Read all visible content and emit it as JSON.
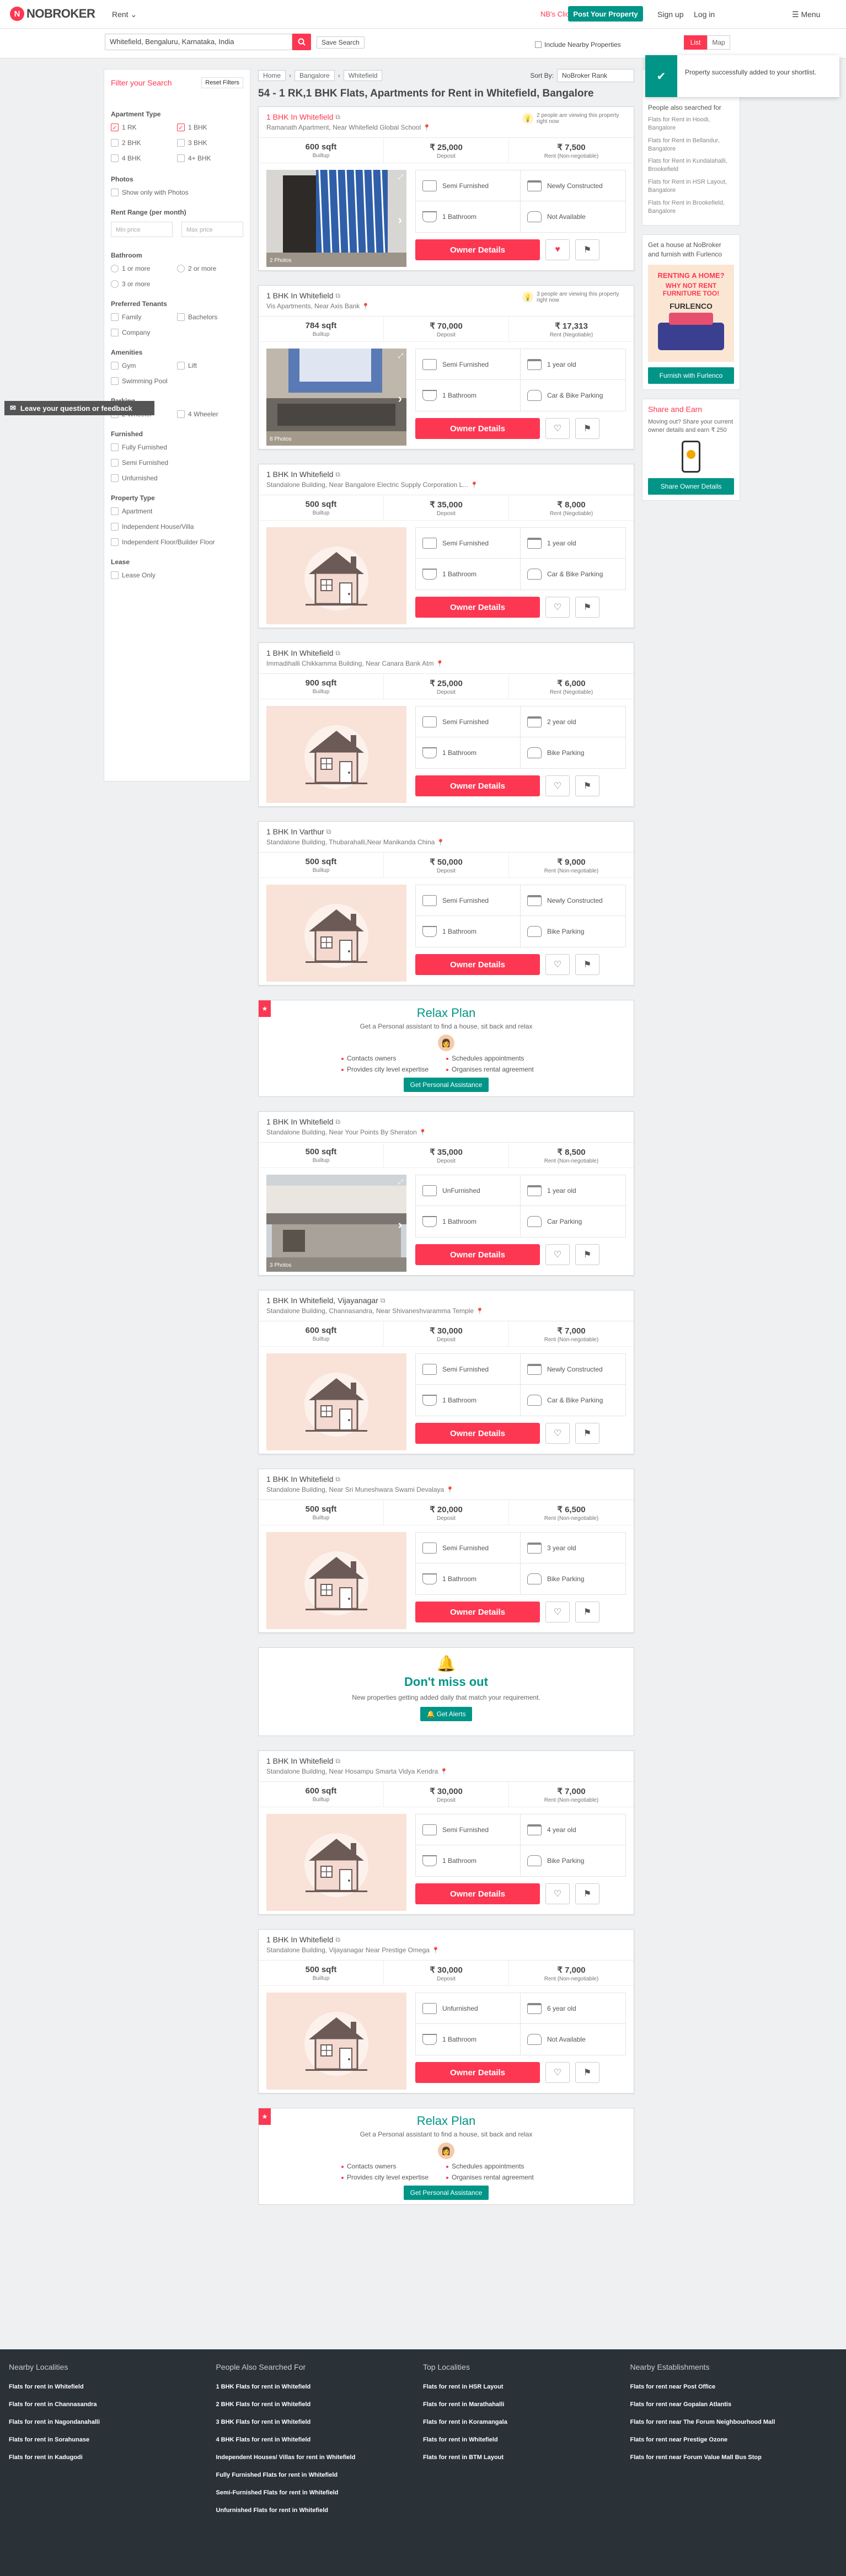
{
  "nav": {
    "logo_initial": "N",
    "logo_text": "NOBROKER",
    "rent_dropdown": "Rent ⌄",
    "help_link": "NB's Click Here!",
    "post_button": "Post Your Property",
    "signup": "Sign up",
    "login": "Log in",
    "menu": "☰ Menu"
  },
  "search": {
    "value": "Whitefield, Bengaluru, Karnataka, India",
    "save_label": "Save Search",
    "nearby_label": "Include Nearby Properties",
    "list_label": "List",
    "map_label": "Map"
  },
  "toast": {
    "message": "Property successfully added to your shortlist."
  },
  "filters": {
    "title": "Filter your Search",
    "reset": "Reset Filters",
    "apartment_type_label": "Apartment Type",
    "apartment_types": [
      {
        "label": "1 RK",
        "checked": "✓"
      },
      {
        "label": "1 BHK",
        "checked": "✓"
      },
      {
        "label": "2 BHK",
        "checked": ""
      },
      {
        "label": "3 BHK",
        "checked": ""
      },
      {
        "label": "4 BHK",
        "checked": ""
      },
      {
        "label": "4+ BHK",
        "checked": ""
      }
    ],
    "photos_label": "Photos",
    "photos_option": "Show only with Photos",
    "rent_range_label": "Rent Range (per month)",
    "min_price": "Min price",
    "max_price": "Max price",
    "bathroom_label": "Bathroom",
    "bathroom_options": [
      "1 or more",
      "2 or more",
      "3 or more"
    ],
    "tenants_label": "Preferred Tenants",
    "tenants_options": [
      "Family",
      "Bachelors",
      "Company"
    ],
    "amenities_label": "Amenities",
    "amenities_options": [
      "Gym",
      "Lift",
      "Swimming Pool"
    ],
    "parking_label": "Parking",
    "parking_options": [
      "2 Wheeler",
      "4 Wheeler"
    ],
    "furnished_label": "Furnished",
    "furnished_options": [
      "Fully Furnished",
      "Semi Furnished",
      "Unfurnished"
    ],
    "property_type_label": "Property Type",
    "property_type_options": [
      "Apartment",
      "Independent House/Villa",
      "Independent Floor/Builder Floor"
    ],
    "lease_label": "Lease",
    "lease_option": "Lease Only"
  },
  "feedback": {
    "label": "Leave your question or feedback"
  },
  "breadcrumb": {
    "items": [
      "Home",
      "Bangalore",
      "Whitefield"
    ]
  },
  "sort": {
    "label": "Sort By:",
    "value": "NoBroker Rank"
  },
  "page_title": "54 - 1 RK,1 BHK Flats, Apartments for Rent in Whitefield, Bangalore",
  "listings": [
    {
      "title": "1 BHK In Whitefield",
      "subtitle": "Ramanath Apartment, Near Whitefield Global School",
      "viewing": "2 people are viewing this property right now",
      "area": "600 sqft",
      "area_label": "Builtup",
      "deposit": "₹ 25,000",
      "deposit_label": "Deposit",
      "rent": "₹ 7,500",
      "rent_label": "Rent (Non-negotiable)",
      "furnishing": "Semi Furnished",
      "age": "Newly Constructed",
      "bathrooms": "1 Bathroom",
      "parking": "Not Available",
      "photos": "2 Photos",
      "favorite": "♥"
    },
    {
      "title": "1 BHK In Whitefield",
      "subtitle": "Vis Apartments, Near Axis Bank",
      "viewing": "3 people are viewing this property right now",
      "area": "784 sqft",
      "area_label": "Builtup",
      "deposit": "₹ 70,000",
      "deposit_label": "Deposit",
      "rent": "₹ 17,313",
      "rent_label": "Rent (Negotiable)",
      "furnishing": "Semi Furnished",
      "age": "1 year old",
      "bathrooms": "1 Bathroom",
      "parking": "Car & Bike Parking",
      "photos": "8 Photos",
      "favorite": "♡"
    },
    {
      "title": "1 BHK In Whitefield",
      "subtitle": "Standalone Building, Near Bangalore Electric Supply Corporation L...",
      "area": "500 sqft",
      "area_label": "Builtup",
      "deposit": "₹ 35,000",
      "deposit_label": "Deposit",
      "rent": "₹ 8,000",
      "rent_label": "Rent (Negotiable)",
      "furnishing": "Semi Furnished",
      "age": "1 year old",
      "bathrooms": "1 Bathroom",
      "parking": "Car & Bike Parking",
      "favorite": "♡"
    },
    {
      "title": "1 BHK In Whitefield",
      "subtitle": "Immadihalli Chikkamma Building, Near Canara Bank Atm",
      "area": "900 sqft",
      "area_label": "Builtup",
      "deposit": "₹ 25,000",
      "deposit_label": "Deposit",
      "rent": "₹ 6,000",
      "rent_label": "Rent (Negotiable)",
      "furnishing": "Semi Furnished",
      "age": "2 year old",
      "bathrooms": "1 Bathroom",
      "parking": "Bike Parking",
      "favorite": "♡"
    },
    {
      "title": "1 BHK In Varthur",
      "subtitle": "Standalone Building, Thubarahalli,Near Manikanda China",
      "area": "500 sqft",
      "area_label": "Builtup",
      "deposit": "₹ 50,000",
      "deposit_label": "Deposit",
      "rent": "₹ 9,000",
      "rent_label": "Rent (Non-negotiable)",
      "furnishing": "Semi Furnished",
      "age": "Newly Constructed",
      "bathrooms": "1 Bathroom",
      "parking": "Bike Parking",
      "favorite": "♡"
    },
    {
      "title": "1 BHK In Whitefield",
      "subtitle": "Standalone Building, Near Your Points By Sheraton",
      "area": "500 sqft",
      "area_label": "Builtup",
      "deposit": "₹ 35,000",
      "deposit_label": "Deposit",
      "rent": "₹ 8,500",
      "rent_label": "Rent (Non-negotiable)",
      "furnishing": "UnFurnished",
      "age": "1 year old",
      "bathrooms": "1 Bathroom",
      "parking": "Car Parking",
      "photos": "3 Photos",
      "favorite": "♡"
    },
    {
      "title": "1 BHK In Whitefield, Vijayanagar",
      "subtitle": "Standalone Building, Channasandra, Near Shivaneshvaramma Temple",
      "area": "600 sqft",
      "area_label": "Builtup",
      "deposit": "₹ 30,000",
      "deposit_label": "Deposit",
      "rent": "₹ 7,000",
      "rent_label": "Rent (Non-negotiable)",
      "furnishing": "Semi Furnished",
      "age": "Newly Constructed",
      "bathrooms": "1 Bathroom",
      "parking": "Car & Bike Parking",
      "favorite": "♡"
    },
    {
      "title": "1 BHK In Whitefield",
      "subtitle": "Standalone Building, Near Sri Muneshwara Swami Devalaya",
      "area": "500 sqft",
      "area_label": "Builtup",
      "deposit": "₹ 20,000",
      "deposit_label": "Deposit",
      "rent": "₹ 6,500",
      "rent_label": "Rent (Non-negotiable)",
      "furnishing": "Semi Furnished",
      "age": "3 year old",
      "bathrooms": "1 Bathroom",
      "parking": "Bike Parking",
      "favorite": "♡"
    },
    {
      "title": "1 BHK In Whitefield",
      "subtitle": "Standalone Building, Near Hosampu Smarta Vidya Kendra",
      "area": "600 sqft",
      "area_label": "Builtup",
      "deposit": "₹ 30,000",
      "deposit_label": "Deposit",
      "rent": "₹ 7,000",
      "rent_label": "Rent (Non-negotiable)",
      "furnishing": "Semi Furnished",
      "age": "4 year old",
      "bathrooms": "1 Bathroom",
      "parking": "Bike Parking",
      "favorite": "♡"
    },
    {
      "title": "1 BHK In Whitefield",
      "subtitle": "Standalone Building, Vijayanagar Near Prestige Omega",
      "area": "500 sqft",
      "area_label": "Builtup",
      "deposit": "₹ 30,000",
      "deposit_label": "Deposit",
      "rent": "₹ 7,000",
      "rent_label": "Rent (Non-negotiable)",
      "furnishing": "Unfurnished",
      "age": "6 year old",
      "bathrooms": "1 Bathroom",
      "parking": "Not Available",
      "favorite": "♡"
    }
  ],
  "owner_button": "Owner Details",
  "relax": {
    "title": "Relax Plan",
    "subtitle": "Get a Personal assistant to find a house, sit back and relax",
    "bullets": [
      "Contacts owners",
      "Schedules appointments",
      "Provides city level expertise",
      "Organises rental agreement"
    ],
    "button": "Get Personal Assistance"
  },
  "alert": {
    "title": "Don't miss out",
    "subtitle": "New properties getting added daily that match your requirement.",
    "button": "🔔 Get Alerts"
  },
  "right": {
    "searched_title": "People also searched for",
    "searched_links": [
      "Flats for Rent in Hoodi, Bangalore",
      "Flats for Rent in Bellandur, Bangalore",
      "Flats for Rent in Kundalahalli, Brookefield",
      "Flats for Rent in HSR Layout, Bangalore",
      "Flats for Rent in Brookefield, Bangalore"
    ],
    "furl_text": "Get a house at NoBroker and furnish with Furlenco",
    "furl_l1": "RENTING A HOME?",
    "furl_l2": "WHY NOT RENT FURNITURE TOO!",
    "furl_brand": "FURLENCO",
    "furl_button": "Furnish with Furlenco",
    "share_title": "Share and Earn",
    "share_text": "Moving out? Share your current owner details and earn ₹ 250",
    "share_button": "Share Owner Details"
  },
  "footer": [
    {
      "title": "Nearby Localities",
      "links": [
        "Flats for rent in Whitefield",
        "Flats for rent in Channasandra",
        "Flats for rent in Nagondanahalli",
        "Flats for rent in Sorahunase",
        "Flats for rent in Kadugodi"
      ]
    },
    {
      "title": "People Also Searched For",
      "links": [
        "1 BHK Flats for rent in Whitefield",
        "2 BHK Flats for rent in Whitefield",
        "3 BHK Flats for rent in Whitefield",
        "4 BHK Flats for rent in Whitefield",
        "Independent Houses/ Villas for rent in Whitefield",
        "Fully Furnished Flats for rent in Whitefield",
        "Semi-Furnished Flats for rent in Whitefield",
        "Unfurnished Flats for rent in Whitefield"
      ]
    },
    {
      "title": "Top Localities",
      "links": [
        "Flats for rent in HSR Layout",
        "Flats for rent in Marathahalli",
        "Flats for rent in Koramangala",
        "Flats for rent in Whitefield",
        "Flats for rent in BTM Layout"
      ]
    },
    {
      "title": "Nearby Establishments",
      "links": [
        "Flats for rent near Post Office",
        "Flats for rent near Gopalan Atlantis",
        "Flats for rent near The Forum Neighbourhood Mall",
        "Flats for rent near Prestige Ozone",
        "Flats for rent near Forum Value Mall Bus Stop"
      ]
    }
  ],
  "colors": {
    "brand": "#fd3752",
    "accent": "#009587"
  }
}
